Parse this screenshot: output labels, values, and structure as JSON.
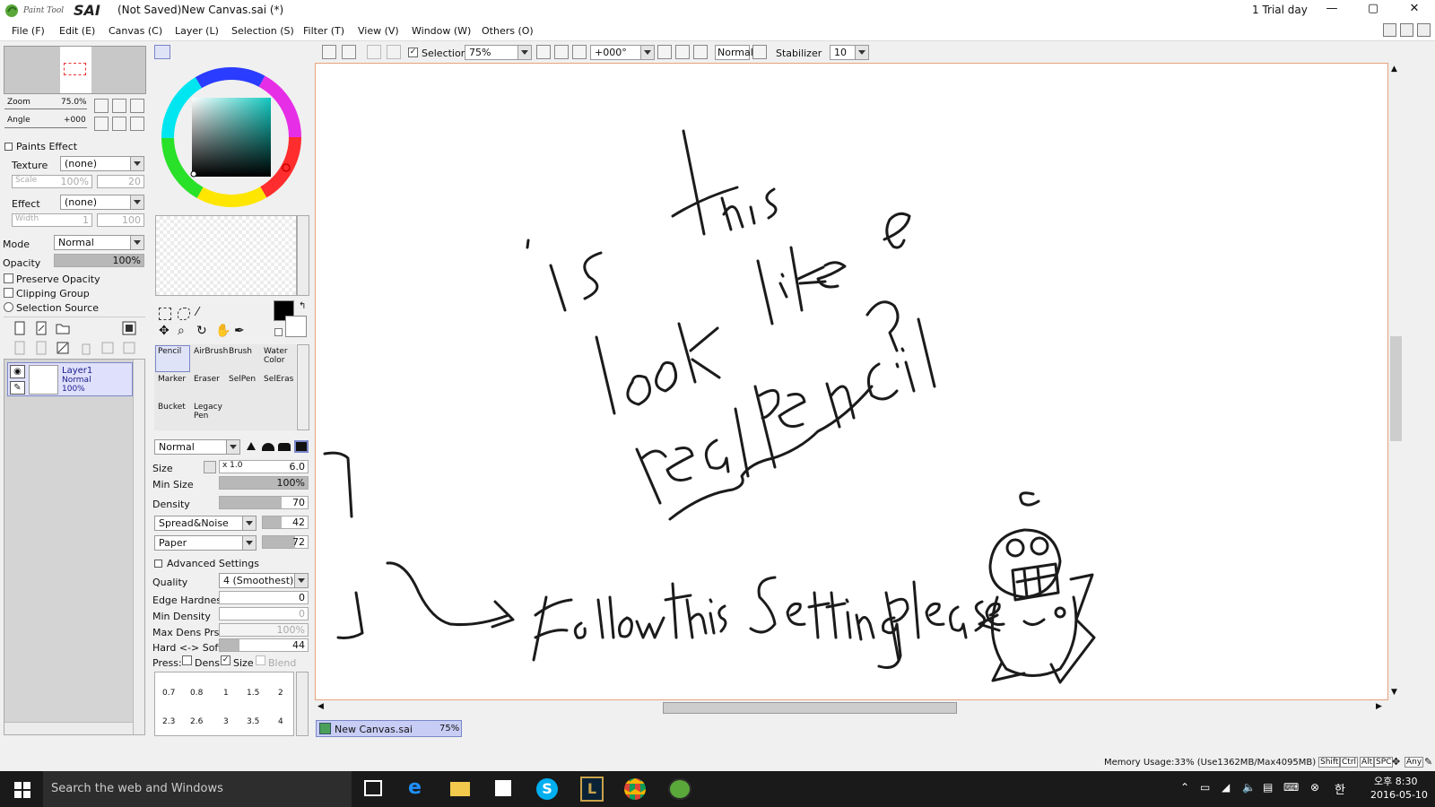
{
  "window": {
    "title": "(Not Saved)New Canvas.sai (*)",
    "trial": "1 Trial day",
    "minimize": "—",
    "maximize": "▢",
    "close": "✕"
  },
  "menu": {
    "items": [
      "File (F)",
      "Edit (E)",
      "Canvas (C)",
      "Layer (L)",
      "Selection (S)",
      "Filter (T)",
      "View (V)",
      "Window (W)",
      "Others (O)"
    ]
  },
  "navigator": {
    "zoom_label": "Zoom",
    "zoom_value": "75.0%",
    "angle_label": "Angle",
    "angle_value": "+000"
  },
  "paints_effect": {
    "header": "Paints Effect",
    "texture_label": "Texture",
    "texture_value": "(none)",
    "scale_label": "Scale",
    "scale_value": "100%",
    "scale_value2": "20",
    "effect_label": "Effect",
    "effect_value": "(none)",
    "width_label": "Width",
    "width_value": "1",
    "width_value2": "100"
  },
  "layer_props": {
    "mode_label": "Mode",
    "mode_value": "Normal",
    "opacity_label": "Opacity",
    "opacity_value": "100%",
    "preserve_opacity": "Preserve Opacity",
    "clipping_group": "Clipping Group",
    "selection_source": "Selection Source"
  },
  "layers": [
    {
      "name": "Layer1",
      "mode": "Normal",
      "opacity": "100%"
    }
  ],
  "tools": {
    "brushes": [
      "Pencil",
      "AirBrush",
      "Brush",
      "Water Color",
      "Marker",
      "Eraser",
      "SelPen",
      "SelEras",
      "Bucket",
      "Legacy Pen"
    ],
    "blend_mode": "Normal",
    "size_label": "Size",
    "size_mult": "x 1.0",
    "size_value": "6.0",
    "min_size_label": "Min Size",
    "min_size_value": "100%",
    "density_label": "Density",
    "density_value": "70",
    "spread_label": "Spread&Noise",
    "spread_value": "42",
    "paper_label": "Paper",
    "paper_value": "72",
    "advanced_header": "Advanced Settings",
    "quality_label": "Quality",
    "quality_value": "4 (Smoothest)",
    "edge_label": "Edge Hardness",
    "edge_value": "0",
    "min_density_label": "Min Density",
    "min_density_value": "0",
    "max_dens_label": "Max Dens Prs.",
    "max_dens_value": "100%",
    "hard_soft_label": "Hard <-> Soft",
    "hard_soft_value": "44",
    "press_label": "Press:",
    "press_dens": "Dens",
    "press_size": "Size",
    "press_blend": "Blend",
    "brush_sizes_row1": [
      "0.7",
      "0.8",
      "1",
      "1.5",
      "2"
    ],
    "brush_sizes_row2": [
      "2.3",
      "2.6",
      "3",
      "3.5",
      "4"
    ]
  },
  "toolbar": {
    "selection_label": "Selection",
    "zoom_value": "75%",
    "angle_value": "+000°",
    "mode_value": "Normal",
    "stabilizer_label": "Stabilizer",
    "stabilizer_value": "10"
  },
  "canvas_tab": {
    "name": "New Canvas.sai",
    "zoom": "75%"
  },
  "status": {
    "memory": "Memory Usage:33% (Use1362MB/Max4095MB)",
    "keys": [
      "Shift",
      "Ctrl",
      "Alt",
      "SPC",
      "Any"
    ]
  },
  "taskbar": {
    "search_placeholder": "Search the web and Windows",
    "time": "오후 8:30",
    "date": "2016-05-10",
    "ime": "한"
  },
  "drawing_text": [
    "is",
    "this",
    "look like",
    "a",
    "real pencil?",
    "Follow this Setting please"
  ]
}
